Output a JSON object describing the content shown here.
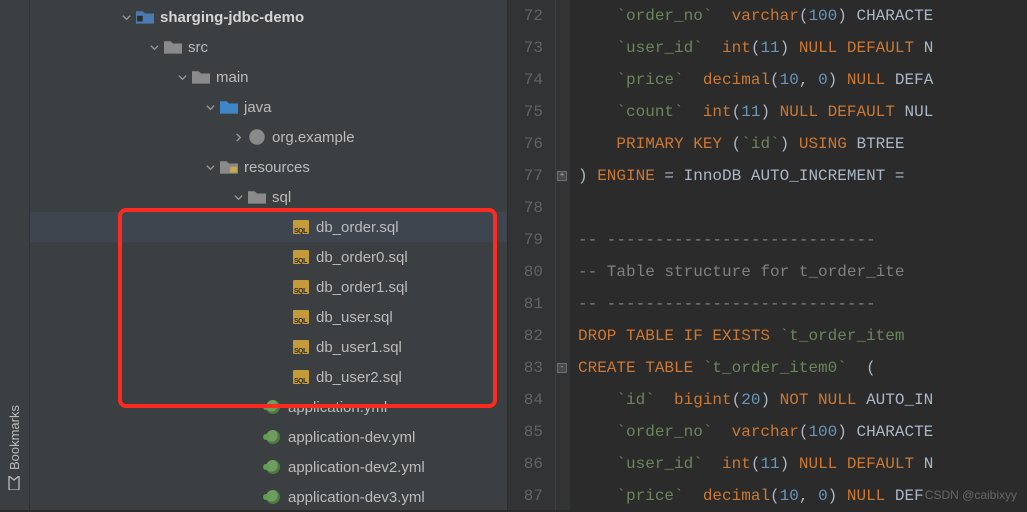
{
  "sidebar_tab": {
    "label": "Bookmarks"
  },
  "tree": [
    {
      "indent": 90,
      "chevron": "down",
      "icon": "project-folder",
      "label": "sharging-jdbc-demo",
      "bold": true
    },
    {
      "indent": 118,
      "chevron": "down",
      "icon": "folder",
      "label": "src"
    },
    {
      "indent": 146,
      "chevron": "down",
      "icon": "folder",
      "label": "main"
    },
    {
      "indent": 174,
      "chevron": "down",
      "icon": "folder-blue",
      "label": "java"
    },
    {
      "indent": 202,
      "chevron": "right",
      "icon": "package",
      "label": "org.example"
    },
    {
      "indent": 174,
      "chevron": "down",
      "icon": "resources-folder",
      "label": "resources"
    },
    {
      "indent": 202,
      "chevron": "down",
      "icon": "folder",
      "label": "sql"
    },
    {
      "indent": 246,
      "chevron": "",
      "icon": "sql",
      "label": "db_order.sql",
      "selected": true
    },
    {
      "indent": 246,
      "chevron": "",
      "icon": "sql",
      "label": "db_order0.sql"
    },
    {
      "indent": 246,
      "chevron": "",
      "icon": "sql",
      "label": "db_order1.sql"
    },
    {
      "indent": 246,
      "chevron": "",
      "icon": "sql",
      "label": "db_user.sql"
    },
    {
      "indent": 246,
      "chevron": "",
      "icon": "sql",
      "label": "db_user1.sql"
    },
    {
      "indent": 246,
      "chevron": "",
      "icon": "sql",
      "label": "db_user2.sql"
    },
    {
      "indent": 218,
      "chevron": "",
      "icon": "yml",
      "label": "application.yml"
    },
    {
      "indent": 218,
      "chevron": "",
      "icon": "yml",
      "label": "application-dev.yml"
    },
    {
      "indent": 218,
      "chevron": "",
      "icon": "yml",
      "label": "application-dev2.yml"
    },
    {
      "indent": 218,
      "chevron": "",
      "icon": "yml",
      "label": "application-dev3.yml"
    }
  ],
  "code_lines": [
    {
      "n": 72,
      "html": "    <span class='bq'>`order_no`</span>  <span class='kw'>varchar</span>(<span class='num'>100</span>) <span class='ident'>CHARACTE</span>"
    },
    {
      "n": 73,
      "html": "    <span class='bq'>`user_id`</span>  <span class='kw'>int</span>(<span class='num'>11</span>) <span class='kw'>NULL DEFAULT</span> <span class='ident'>N</span>"
    },
    {
      "n": 74,
      "html": "    <span class='bq'>`price`</span>  <span class='kw'>decimal</span>(<span class='num'>10</span>, <span class='num'>0</span>) <span class='kw'>NULL</span> <span class='ident'>DEFA</span>"
    },
    {
      "n": 75,
      "html": "    <span class='bq'>`count`</span>  <span class='kw'>int</span>(<span class='num'>11</span>) <span class='kw'>NULL DEFAULT</span> <span class='ident'>NUL</span>"
    },
    {
      "n": 76,
      "html": "    <span class='kw'>PRIMARY KEY</span> (<span class='bq'>`id`</span>) <span class='kw'>USING</span> <span class='ident'>BTREE</span>"
    },
    {
      "n": 77,
      "html": ") <span class='kw'>ENGINE</span> = <span class='ident'>InnoDB</span> <span class='ident'>AUTO_INCREMENT</span> =",
      "fold": "close"
    },
    {
      "n": 78,
      "html": ""
    },
    {
      "n": 79,
      "html": "<span class='cmt'>-- ----------------------------</span>"
    },
    {
      "n": 80,
      "html": "<span class='cmt'>-- Table structure for t_order_ite</span>"
    },
    {
      "n": 81,
      "html": "<span class='cmt'>-- ----------------------------</span>"
    },
    {
      "n": 82,
      "html": "<span class='kw'>DROP TABLE IF EXISTS</span> <span class='bq'>`t_order_item</span>"
    },
    {
      "n": 83,
      "html": "<span class='kw'>CREATE TABLE</span> <span class='bq'>`t_order_item0`</span>  (",
      "fold": "open"
    },
    {
      "n": 84,
      "html": "    <span class='bq'>`id`</span>  <span class='kw'>bigint</span>(<span class='num'>20</span>) <span class='kw'>NOT NULL</span> <span class='ident'>AUTO_IN</span>"
    },
    {
      "n": 85,
      "html": "    <span class='bq'>`order_no`</span>  <span class='kw'>varchar</span>(<span class='num'>100</span>) <span class='ident'>CHARACTE</span>"
    },
    {
      "n": 86,
      "html": "    <span class='bq'>`user_id`</span>  <span class='kw'>int</span>(<span class='num'>11</span>) <span class='kw'>NULL DEFAULT</span> <span class='ident'>N</span>"
    },
    {
      "n": 87,
      "html": "    <span class='bq'>`price`</span>  <span class='kw'>decimal</span>(<span class='num'>10</span>, <span class='num'>0</span>) <span class='kw'>NULL</span> <span class='ident'>DEF</span>"
    }
  ],
  "watermark": "CSDN @caibixyy"
}
